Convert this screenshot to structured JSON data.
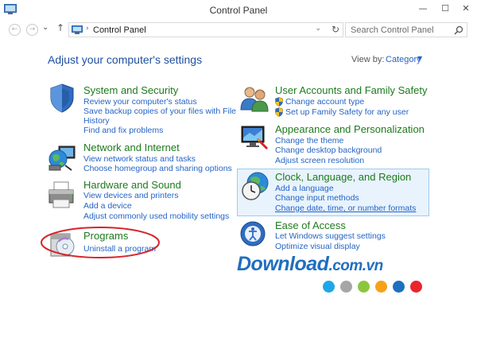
{
  "window": {
    "title": "Control Panel",
    "controls": {
      "minimize": "—",
      "maximize": "☐",
      "close": "✕"
    }
  },
  "nav": {
    "back_glyph": "←",
    "forward_glyph": "→",
    "recent_glyph": "⌄",
    "up_glyph": "↑",
    "address_separator": "›",
    "address_text": "Control Panel",
    "address_dropdown": "⌄",
    "refresh_glyph": "↻",
    "search_placeholder": "Search Control Panel"
  },
  "main": {
    "heading": "Adjust your computer's settings",
    "view_by_label": "View by:",
    "view_by_value": "Category",
    "view_by_arrow": "▼"
  },
  "categories": {
    "system": {
      "title": "System and Security",
      "links": [
        "Review your computer's status",
        "Save backup copies of your files with File",
        "History",
        "Find and fix problems"
      ]
    },
    "network": {
      "title": "Network and Internet",
      "links": [
        "View network status and tasks",
        "Choose homegroup and sharing options"
      ]
    },
    "hardware": {
      "title": "Hardware and Sound",
      "links": [
        "View devices and printers",
        "Add a device",
        "Adjust commonly used mobility settings"
      ]
    },
    "programs": {
      "title": "Programs",
      "links": [
        "Uninstall a program"
      ]
    },
    "users": {
      "title": "User Accounts and Family Safety",
      "links": [
        "Change account type",
        "Set up Family Safety for any user"
      ]
    },
    "appearance": {
      "title": "Appearance and Personalization",
      "links": [
        "Change the theme",
        "Change desktop background",
        "Adjust screen resolution"
      ]
    },
    "clock": {
      "title": "Clock, Language, and Region",
      "links": [
        "Add a language",
        "Change input methods",
        "Change date, time, or number formats"
      ]
    },
    "ease": {
      "title": "Ease of Access",
      "links": [
        "Let Windows suggest settings",
        "Optimize visual display"
      ]
    }
  },
  "watermark": {
    "main": "Download",
    "domain": ".com.vn",
    "dot_colors": [
      "#1ea7e8",
      "#a6a6a6",
      "#8cc63f",
      "#f7a21b",
      "#1f6fbf",
      "#e8262d"
    ]
  },
  "colors": {
    "link": "#2464c6",
    "category_title": "#1e7a1e",
    "heading": "#1e4e9e",
    "highlight_bg": "#e8f3fd",
    "highlight_border": "#9fcbee",
    "annotation": "#d8232a"
  }
}
